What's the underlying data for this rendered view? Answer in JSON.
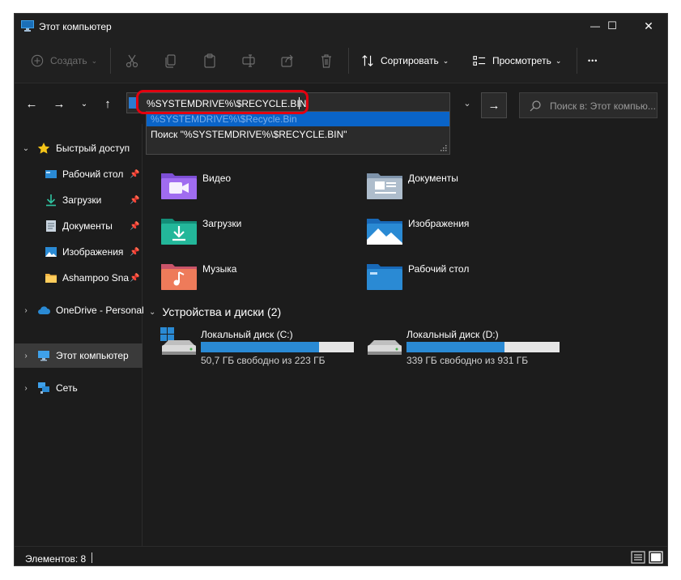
{
  "window": {
    "title": "Этот компьютер",
    "minimize_glyph": "—",
    "maximize_glyph": "☐",
    "close_glyph": "✕"
  },
  "toolbar": {
    "create_label": "Создать",
    "sort_label": "Сортировать",
    "view_label": "Просмотреть",
    "more_glyph": "•••"
  },
  "address": {
    "value": "%SYSTEMDRIVE%\\$RECYCLE.BIN",
    "search_placeholder": "Поиск в: Этот компью..."
  },
  "autocomplete": {
    "items": [
      {
        "label": "%SYSTEMDRIVE%\\$Recycle.Bin",
        "selected": true
      },
      {
        "label": "Поиск \"%SYSTEMDRIVE%\\$RECYCLE.BIN\"",
        "selected": false
      }
    ]
  },
  "sidebar": {
    "quick_access": "Быстрый доступ",
    "items": [
      {
        "label": "Рабочий стол"
      },
      {
        "label": "Загрузки"
      },
      {
        "label": "Документы"
      },
      {
        "label": "Изображения"
      },
      {
        "label": "Ashampoo Sna"
      }
    ],
    "onedrive": "OneDrive - Personal",
    "this_pc": "Этот компьютер",
    "network": "Сеть"
  },
  "folders": [
    {
      "label": "Видео",
      "icon": "videos-folder-icon"
    },
    {
      "label": "Документы",
      "icon": "documents-folder-icon"
    },
    {
      "label": "Загрузки",
      "icon": "downloads-folder-icon"
    },
    {
      "label": "Изображения",
      "icon": "pictures-folder-icon"
    },
    {
      "label": "Музыка",
      "icon": "music-folder-icon"
    },
    {
      "label": "Рабочий стол",
      "icon": "desktop-folder-icon"
    }
  ],
  "devices": {
    "header": "Устройства и диски (2)",
    "drives": [
      {
        "name": "Локальный диск (C:)",
        "free": "50,7 ГБ свободно из 223 ГБ",
        "used_fraction": 0.77
      },
      {
        "name": "Локальный диск (D:)",
        "free": "339 ГБ свободно из 931 ГБ",
        "used_fraction": 0.64
      }
    ]
  },
  "status": {
    "count": "Элементов: 8"
  },
  "colors": {
    "accent": "#0a64c8",
    "drive_bar": "#2a8ad4",
    "highlight": "#e3000f"
  }
}
